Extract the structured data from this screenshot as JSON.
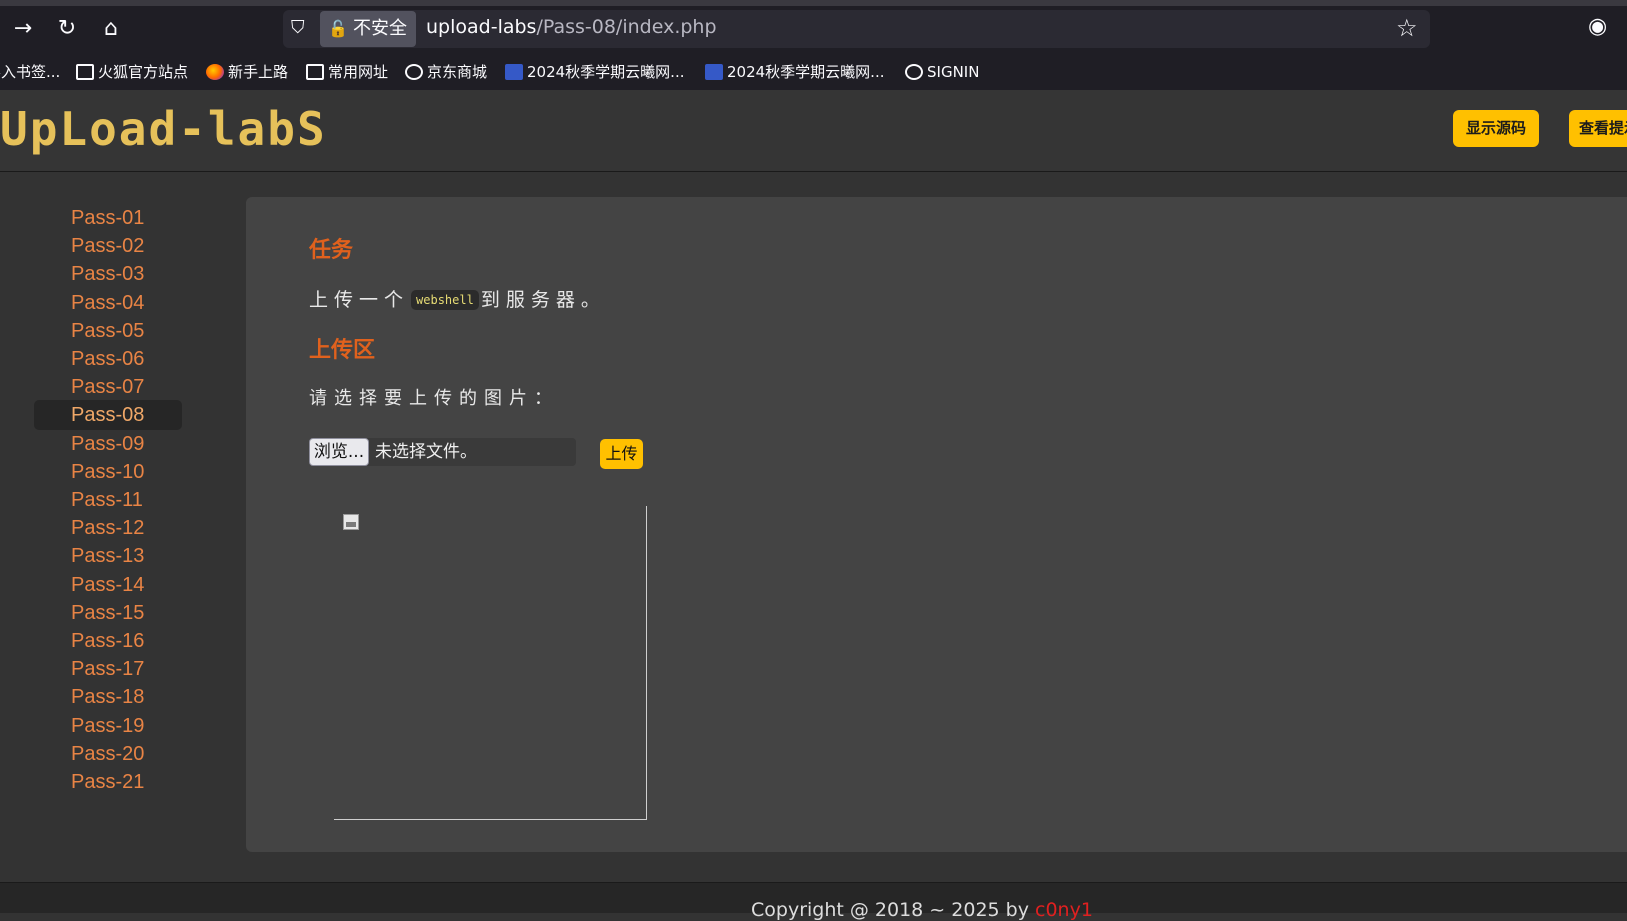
{
  "browser": {
    "security_label": "不安全",
    "url_host": "upload-labs",
    "url_path": "/Pass-08/index.php",
    "bookmarks": [
      "导入书签...",
      "火狐官方站点",
      "新手上路",
      "常用网址",
      "京东商城",
      "2024秋季学期云曦网...",
      "2024秋季学期云曦网...",
      "SIGNIN"
    ]
  },
  "header": {
    "logo_text": "UpLoad-labS",
    "show_source_label": "显示源码",
    "view_hint_label": "查看提示"
  },
  "sidebar": {
    "items": [
      "Pass-01",
      "Pass-02",
      "Pass-03",
      "Pass-04",
      "Pass-05",
      "Pass-06",
      "Pass-07",
      "Pass-08",
      "Pass-09",
      "Pass-10",
      "Pass-11",
      "Pass-12",
      "Pass-13",
      "Pass-14",
      "Pass-15",
      "Pass-16",
      "Pass-17",
      "Pass-18",
      "Pass-19",
      "Pass-20",
      "Pass-21"
    ],
    "active": "Pass-08"
  },
  "main": {
    "task_heading": "任务",
    "task_before": "上传一个",
    "task_code": "webshell",
    "task_after": "到服务器。",
    "upload_heading": "上传区",
    "prompt": "请选择要上传的图片：",
    "browse_label": "浏览...",
    "no_file_label": "未选择文件。",
    "submit_label": "上传"
  },
  "footer": {
    "copyright_prefix": "Copyright @ 2018 ~ 2025 by ",
    "author": "c0ny1"
  },
  "colors": {
    "accent": "#ffc000",
    "heading": "#e0611d",
    "nav_link": "#e98445",
    "panel_bg": "#444444",
    "page_bg": "#333333"
  }
}
